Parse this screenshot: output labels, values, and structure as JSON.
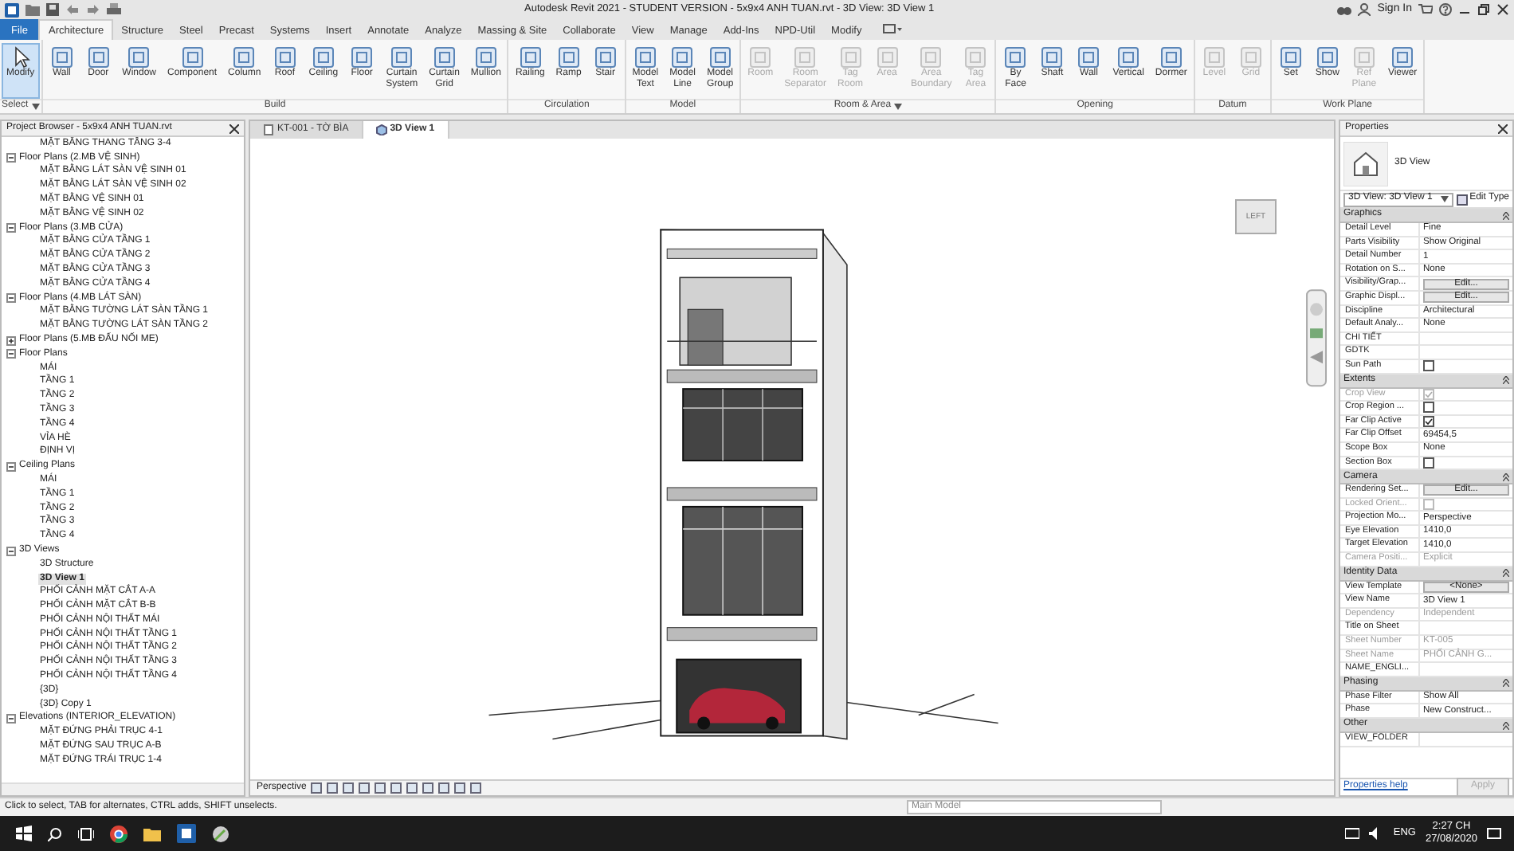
{
  "title_bar": {
    "title": "Autodesk Revit 2021 - STUDENT VERSION - 5x9x4 ANH TUAN.rvt - 3D View: 3D View 1",
    "sign_in": "Sign In"
  },
  "ribbon_tabs": [
    {
      "label": "File",
      "kind": "file",
      "selected": false
    },
    {
      "label": "Architecture",
      "kind": "tab",
      "selected": true
    },
    {
      "label": "Structure",
      "kind": "tab",
      "selected": false
    },
    {
      "label": "Steel",
      "kind": "tab",
      "selected": false
    },
    {
      "label": "Precast",
      "kind": "tab",
      "selected": false
    },
    {
      "label": "Systems",
      "kind": "tab",
      "selected": false
    },
    {
      "label": "Insert",
      "kind": "tab",
      "selected": false
    },
    {
      "label": "Annotate",
      "kind": "tab",
      "selected": false
    },
    {
      "label": "Analyze",
      "kind": "tab",
      "selected": false
    },
    {
      "label": "Massing & Site",
      "kind": "tab",
      "selected": false
    },
    {
      "label": "Collaborate",
      "kind": "tab",
      "selected": false
    },
    {
      "label": "View",
      "kind": "tab",
      "selected": false
    },
    {
      "label": "Manage",
      "kind": "tab",
      "selected": false
    },
    {
      "label": "Add-Ins",
      "kind": "tab",
      "selected": false
    },
    {
      "label": "NPD-Util",
      "kind": "tab",
      "selected": false
    },
    {
      "label": "Modify",
      "kind": "tab",
      "selected": false
    }
  ],
  "ribbon_panels": [
    {
      "title": "Select",
      "menu": true,
      "buttons": [
        {
          "label": "Modify",
          "disabled": false,
          "selected": true
        }
      ]
    },
    {
      "title": "Build",
      "menu": false,
      "buttons": [
        {
          "label": "Wall",
          "disabled": false,
          "selected": false
        },
        {
          "label": "Door",
          "disabled": false,
          "selected": false
        },
        {
          "label": "Window",
          "disabled": false,
          "selected": false
        },
        {
          "label": "Component",
          "disabled": false,
          "selected": false
        },
        {
          "label": "Column",
          "disabled": false,
          "selected": false
        },
        {
          "label": "Roof",
          "disabled": false,
          "selected": false
        },
        {
          "label": "Ceiling",
          "disabled": false,
          "selected": false
        },
        {
          "label": "Floor",
          "disabled": false,
          "selected": false
        },
        {
          "label": "Curtain System",
          "disabled": false,
          "selected": false
        },
        {
          "label": "Curtain Grid",
          "disabled": false,
          "selected": false
        },
        {
          "label": "Mullion",
          "disabled": false,
          "selected": false
        }
      ]
    },
    {
      "title": "Circulation",
      "menu": false,
      "buttons": [
        {
          "label": "Railing",
          "disabled": false,
          "selected": false
        },
        {
          "label": "Ramp",
          "disabled": false,
          "selected": false
        },
        {
          "label": "Stair",
          "disabled": false,
          "selected": false
        }
      ]
    },
    {
      "title": "Model",
      "menu": false,
      "buttons": [
        {
          "label": "Model Text",
          "disabled": false,
          "selected": false
        },
        {
          "label": "Model Line",
          "disabled": false,
          "selected": false
        },
        {
          "label": "Model Group",
          "disabled": false,
          "selected": false
        }
      ]
    },
    {
      "title": "Room & Area",
      "menu": true,
      "buttons": [
        {
          "label": "Room",
          "disabled": true,
          "selected": false
        },
        {
          "label": "Room Separator",
          "disabled": true,
          "selected": false
        },
        {
          "label": "Tag Room",
          "disabled": true,
          "selected": false
        },
        {
          "label": "Area",
          "disabled": true,
          "selected": false
        },
        {
          "label": "Area Boundary",
          "disabled": true,
          "selected": false
        },
        {
          "label": "Tag Area",
          "disabled": true,
          "selected": false
        }
      ]
    },
    {
      "title": "Opening",
      "menu": false,
      "buttons": [
        {
          "label": "By Face",
          "disabled": false,
          "selected": false
        },
        {
          "label": "Shaft",
          "disabled": false,
          "selected": false
        },
        {
          "label": "Wall",
          "disabled": false,
          "selected": false
        },
        {
          "label": "Vertical",
          "disabled": false,
          "selected": false
        },
        {
          "label": "Dormer",
          "disabled": false,
          "selected": false
        }
      ]
    },
    {
      "title": "Datum",
      "menu": false,
      "buttons": [
        {
          "label": "Level",
          "disabled": true,
          "selected": false
        },
        {
          "label": "Grid",
          "disabled": true,
          "selected": false
        }
      ]
    },
    {
      "title": "Work Plane",
      "menu": false,
      "buttons": [
        {
          "label": "Set",
          "disabled": false,
          "selected": false
        },
        {
          "label": "Show",
          "disabled": false,
          "selected": false
        },
        {
          "label": "Ref Plane",
          "disabled": true,
          "selected": false
        },
        {
          "label": "Viewer",
          "disabled": false,
          "selected": false
        }
      ]
    }
  ],
  "project_browser": {
    "title": "Project Browser - 5x9x4 ANH TUAN.rvt",
    "tree": [
      {
        "children": [
          {
            "label": "MẶT BẰNG THANG TẦNG 3-4",
            "selected": false
          }
        ]
      },
      {
        "label": "Floor Plans (2.MB VỆ SINH)",
        "expanded": true,
        "children": [
          {
            "label": "MẶT BẰNG LÁT SÀN VỆ SINH 01",
            "selected": false
          },
          {
            "label": "MẶT BẰNG LÁT SÀN VỆ SINH 02",
            "selected": false
          },
          {
            "label": "MẶT BẰNG VỆ SINH 01",
            "selected": false
          },
          {
            "label": "MẶT BẰNG VỆ SINH 02",
            "selected": false
          }
        ]
      },
      {
        "label": "Floor Plans (3.MB CỬA)",
        "expanded": true,
        "children": [
          {
            "label": "MẶT BẰNG CỬA TẦNG 1",
            "selected": false
          },
          {
            "label": "MẶT BẰNG CỬA TẦNG 2",
            "selected": false
          },
          {
            "label": "MẶT BẰNG CỬA TẦNG 3",
            "selected": false
          },
          {
            "label": "MẶT BẰNG CỬA TẦNG 4",
            "selected": false
          }
        ]
      },
      {
        "label": "Floor Plans (4.MB LÁT SÀN)",
        "expanded": true,
        "children": [
          {
            "label": "MẶT BẰNG TƯỜNG LÁT SÀN TẦNG 1",
            "selected": false
          },
          {
            "label": "MẶT BẰNG TƯỜNG LÁT SÀN TẦNG 2",
            "selected": false
          }
        ]
      },
      {
        "label": "Floor Plans (5.MB ĐẤU NỐI ME)",
        "expanded": false
      },
      {
        "label": "Floor Plans",
        "expanded": true,
        "children": [
          {
            "label": "MÁI",
            "selected": false
          },
          {
            "label": "TẦNG 1",
            "selected": false
          },
          {
            "label": "TẦNG 2",
            "selected": false
          },
          {
            "label": "TẦNG 3",
            "selected": false
          },
          {
            "label": "TẦNG 4",
            "selected": false
          },
          {
            "label": "VỈA HÈ",
            "selected": false
          },
          {
            "label": "ĐỊNH VỊ",
            "selected": false
          }
        ]
      },
      {
        "label": "Ceiling Plans",
        "expanded": true,
        "children": [
          {
            "label": "MÁI",
            "selected": false
          },
          {
            "label": "TẦNG 1",
            "selected": false
          },
          {
            "label": "TẦNG 2",
            "selected": false
          },
          {
            "label": "TẦNG 3",
            "selected": false
          },
          {
            "label": "TẦNG 4",
            "selected": false
          }
        ]
      },
      {
        "label": "3D Views",
        "expanded": true,
        "children": [
          {
            "label": "3D Structure",
            "selected": false
          },
          {
            "label": "3D View 1",
            "selected": true
          },
          {
            "label": "PHỐI CẢNH MẶT CẮT A-A",
            "selected": false
          },
          {
            "label": "PHỐI CẢNH MẶT CẮT B-B",
            "selected": false
          },
          {
            "label": "PHỐI CẢNH NỘI THẤT MÁI",
            "selected": false
          },
          {
            "label": "PHỐI CẢNH NỘI THẤT TẦNG 1",
            "selected": false
          },
          {
            "label": "PHỐI CẢNH NỘI THẤT TẦNG 2",
            "selected": false
          },
          {
            "label": "PHỐI CẢNH NỘI THẤT TẦNG 3",
            "selected": false
          },
          {
            "label": "PHỐI CẢNH NỘI THẤT TẦNG 4",
            "selected": false
          },
          {
            "label": "{3D}",
            "selected": false
          },
          {
            "label": "{3D} Copy 1",
            "selected": false
          }
        ]
      },
      {
        "label": "Elevations (INTERIOR_ELEVATION)",
        "expanded": true,
        "children": [
          {
            "label": "MẶT ĐỨNG PHẢI TRỤC 4-1",
            "selected": false
          },
          {
            "label": "MẶT ĐỨNG SAU TRỤC A-B",
            "selected": false
          },
          {
            "label": "MẶT ĐỨNG TRÁI TRỤC 1-4",
            "selected": false
          }
        ]
      }
    ]
  },
  "view_tabs": [
    {
      "label": "KT-001 - TỜ BÌA",
      "selected": false
    },
    {
      "label": "3D View 1",
      "selected": true
    }
  ],
  "view": {
    "viewcube_label": "LEFT",
    "view_label": "Perspective"
  },
  "properties": {
    "title": "Properties",
    "type_name": "3D View",
    "selector": "3D View: 3D View 1",
    "edit_type": "Edit Type",
    "sections": [
      {
        "title": "Graphics",
        "rows": [
          {
            "kind": "text",
            "name": "Detail Level",
            "value": "Fine",
            "disabled": false
          },
          {
            "kind": "text",
            "name": "Parts Visibility",
            "value": "Show Original",
            "disabled": false
          },
          {
            "kind": "text",
            "name": "Detail Number",
            "value": "1",
            "disabled": false
          },
          {
            "kind": "text",
            "name": "Rotation on S...",
            "value": "None",
            "disabled": false
          },
          {
            "kind": "button",
            "name": "Visibility/Grap...",
            "value": "Edit...",
            "disabled": false
          },
          {
            "kind": "button",
            "name": "Graphic Displ...",
            "value": "Edit...",
            "disabled": false
          },
          {
            "kind": "text",
            "name": "Discipline",
            "value": "Architectural",
            "disabled": false
          },
          {
            "kind": "text",
            "name": "Default Analy...",
            "value": "None",
            "disabled": false
          },
          {
            "kind": "text",
            "name": "CHI TIẾT",
            "disabled": false
          },
          {
            "kind": "text",
            "name": "GDTK",
            "disabled": false
          },
          {
            "kind": "check",
            "name": "Sun Path",
            "checked": false,
            "disabled": false
          }
        ]
      },
      {
        "title": "Extents",
        "rows": [
          {
            "kind": "check",
            "name": "Crop View",
            "checked": true,
            "disabled": true
          },
          {
            "kind": "check",
            "name": "Crop Region ...",
            "checked": false,
            "disabled": false
          },
          {
            "kind": "check",
            "name": "Far Clip Active",
            "checked": true,
            "disabled": false
          },
          {
            "kind": "text",
            "name": "Far Clip Offset",
            "value": "69454,5",
            "disabled": false
          },
          {
            "kind": "text",
            "name": "Scope Box",
            "value": "None",
            "disabled": false
          },
          {
            "kind": "check",
            "name": "Section Box",
            "checked": false,
            "disabled": false
          }
        ]
      },
      {
        "title": "Camera",
        "rows": [
          {
            "kind": "button",
            "name": "Rendering Set...",
            "value": "Edit...",
            "disabled": false
          },
          {
            "kind": "check",
            "name": "Locked Orient...",
            "checked": false,
            "disabled": true
          },
          {
            "kind": "text",
            "name": "Projection Mo...",
            "value": "Perspective",
            "disabled": false
          },
          {
            "kind": "text",
            "name": "Eye Elevation",
            "value": "1410,0",
            "disabled": false
          },
          {
            "kind": "text",
            "name": "Target Elevation",
            "value": "1410,0",
            "disabled": false
          },
          {
            "kind": "text",
            "name": "Camera Positi...",
            "value": "Explicit",
            "disabled": true
          }
        ]
      },
      {
        "title": "Identity Data",
        "rows": [
          {
            "kind": "button",
            "name": "View Template",
            "value": "<None>",
            "disabled": false
          },
          {
            "kind": "text",
            "name": "View Name",
            "value": "3D View 1",
            "disabled": false
          },
          {
            "kind": "text",
            "name": "Dependency",
            "value": "Independent",
            "disabled": true
          },
          {
            "kind": "text",
            "name": "Title on Sheet",
            "disabled": false
          },
          {
            "kind": "text",
            "name": "Sheet Number",
            "value": "KT-005",
            "disabled": true
          },
          {
            "kind": "text",
            "name": "Sheet Name",
            "value": "PHỐI CẢNH G...",
            "disabled": true
          },
          {
            "kind": "text",
            "name": "NAME_ENGLI...",
            "disabled": false
          }
        ]
      },
      {
        "title": "Phasing",
        "rows": [
          {
            "kind": "text",
            "name": "Phase Filter",
            "value": "Show All",
            "disabled": false
          },
          {
            "kind": "text",
            "name": "Phase",
            "value": "New Construct...",
            "disabled": false
          }
        ]
      },
      {
        "title": "Other",
        "rows": [
          {
            "kind": "text",
            "name": "VIEW_FOLDER",
            "disabled": false
          }
        ]
      }
    ],
    "help": "Properties help",
    "apply": "Apply",
    "apply_disabled": true
  },
  "status_bar": {
    "hint": "Click to select, TAB for alternates, CTRL adds, SHIFT unselects.",
    "model": "Main Model"
  },
  "taskbar": {
    "language": "ENG",
    "time": "2:27 CH",
    "date": "27/08/2020"
  }
}
